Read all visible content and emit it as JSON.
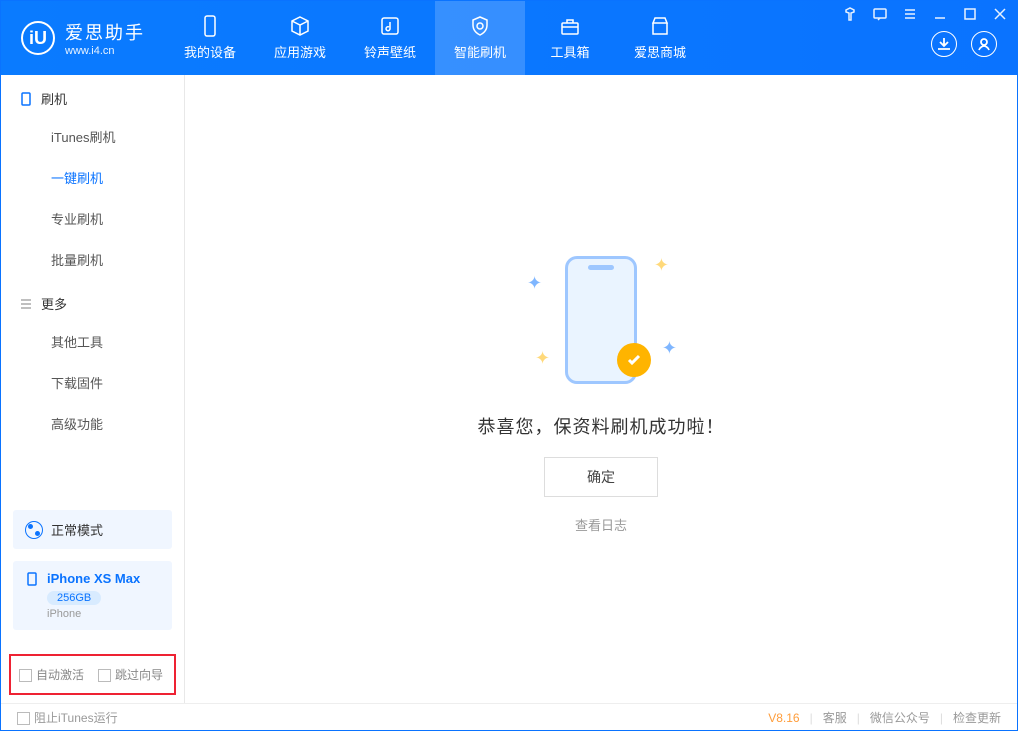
{
  "app": {
    "title": "爱思助手",
    "url": "www.i4.cn"
  },
  "nav": [
    {
      "label": "我的设备"
    },
    {
      "label": "应用游戏"
    },
    {
      "label": "铃声壁纸"
    },
    {
      "label": "智能刷机"
    },
    {
      "label": "工具箱"
    },
    {
      "label": "爱思商城"
    }
  ],
  "sidebar": {
    "sec1": {
      "title": "刷机"
    },
    "items1": [
      {
        "label": "iTunes刷机"
      },
      {
        "label": "一键刷机"
      },
      {
        "label": "专业刷机"
      },
      {
        "label": "批量刷机"
      }
    ],
    "sec2": {
      "title": "更多"
    },
    "items2": [
      {
        "label": "其他工具"
      },
      {
        "label": "下载固件"
      },
      {
        "label": "高级功能"
      }
    ]
  },
  "mode": {
    "label": "正常模式"
  },
  "device": {
    "name": "iPhone XS Max",
    "storage": "256GB",
    "line": "iPhone"
  },
  "opts": {
    "auto_activate": "自动激活",
    "skip_guide": "跳过向导"
  },
  "main": {
    "message": "恭喜您，保资料刷机成功啦！",
    "ok": "确定",
    "viewlog": "查看日志"
  },
  "footer": {
    "block_itunes": "阻止iTunes运行",
    "version": "V8.16",
    "support": "客服",
    "wechat": "微信公众号",
    "update": "检查更新"
  }
}
